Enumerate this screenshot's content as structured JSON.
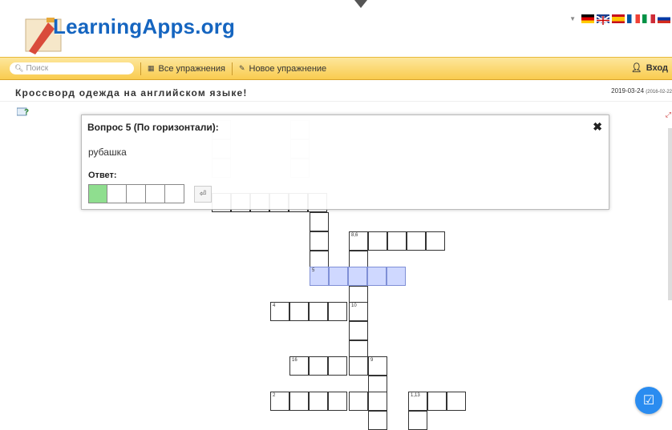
{
  "header": {
    "logo_text": "LearningApps.org",
    "languages": [
      "de",
      "en",
      "es",
      "fr",
      "it",
      "ru"
    ]
  },
  "navbar": {
    "search_placeholder": "Поиск",
    "all_exercises": "Все упражнения",
    "new_exercise": "Новое упражнение",
    "login": "Вход"
  },
  "page": {
    "title": "Кроссворд одежда на английском языке!",
    "date": "2019-03-24",
    "date_created": "(2016-02-22"
  },
  "crossword": {
    "cells": [
      {
        "label": "8,6"
      },
      {
        "label": "5"
      },
      {
        "label": "4"
      },
      {
        "label": "10"
      },
      {
        "label": "16"
      },
      {
        "label": "9"
      },
      {
        "label": "2"
      },
      {
        "label": "1,13"
      }
    ]
  },
  "dialog": {
    "title": "Вопрос 5 (По горизонтали):",
    "clue": "рубашка",
    "answer_label": "Ответ:",
    "answer_length": 5,
    "close_icon": "close-icon",
    "enter_icon": "enter-icon"
  },
  "colors": {
    "navbar": "#f9cc4f",
    "logo": "#1565c0",
    "highlight": "#cfd8ff",
    "answer_active": "#8fde8f",
    "fab": "#2a8cf0"
  }
}
